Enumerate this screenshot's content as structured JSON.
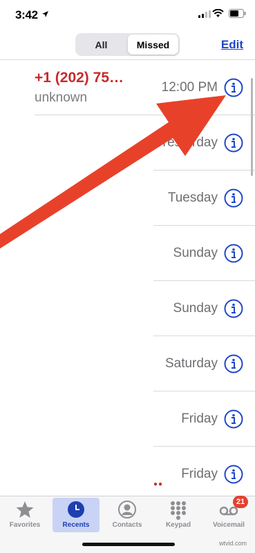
{
  "status_bar": {
    "time": "3:42"
  },
  "filter": {
    "all_label": "All",
    "missed_label": "Missed",
    "selected": "Missed"
  },
  "edit_label": "Edit",
  "first_entry": {
    "caller": "+1 (202) 75…",
    "label": "unknown",
    "time": "12:00 PM"
  },
  "entries": [
    {
      "time": "Yesterday"
    },
    {
      "time": "Tuesday"
    },
    {
      "time": "Sunday"
    },
    {
      "time": "Sunday"
    },
    {
      "time": "Saturday"
    },
    {
      "time": "Friday"
    },
    {
      "time": "Friday"
    }
  ],
  "tab_bar": {
    "favorites": "Favorites",
    "recents": "Recents",
    "contacts": "Contacts",
    "keypad": "Keypad",
    "voicemail": "Voicemail",
    "voicemail_badge": "21",
    "active": "Recents"
  },
  "watermark": "wtvid.com",
  "colors": {
    "accent": "#1d47c9",
    "missed_red": "#c62b2b",
    "arrow_red": "#e8412a"
  }
}
